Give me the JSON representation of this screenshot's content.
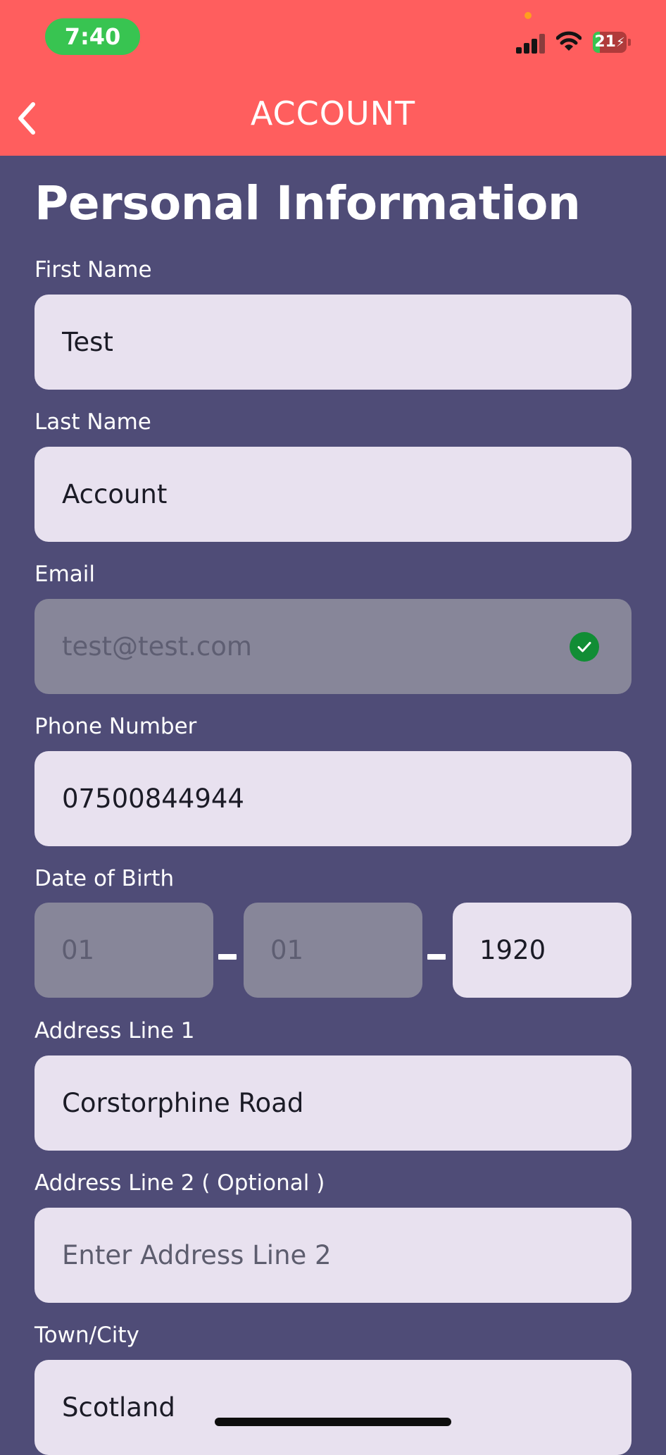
{
  "status_bar": {
    "time": "7:40",
    "battery": "21"
  },
  "header": {
    "title": "ACCOUNT"
  },
  "page": {
    "heading": "Personal Information"
  },
  "fields": {
    "first_name": {
      "label": "First Name",
      "value": "Test"
    },
    "last_name": {
      "label": "Last Name",
      "value": "Account"
    },
    "email": {
      "label": "Email",
      "value": "test@test.com",
      "verified": true
    },
    "phone": {
      "label": "Phone Number",
      "value": "07500844944"
    },
    "dob": {
      "label": "Date of Birth",
      "day": "01",
      "month": "01",
      "year": "1920"
    },
    "address1": {
      "label": "Address Line 1",
      "value": "Corstorphine Road"
    },
    "address2": {
      "label": "Address Line 2 ( Optional )",
      "value": "",
      "placeholder": "Enter Address Line 2"
    },
    "town": {
      "label": "Town/City",
      "value": "Scotland"
    }
  },
  "colors": {
    "header": "#ff5e5e",
    "background": "#4f4c77",
    "field": "#e8e1ef",
    "field_disabled": "#878699",
    "verified": "#118d35",
    "time_pill": "#38c451"
  }
}
